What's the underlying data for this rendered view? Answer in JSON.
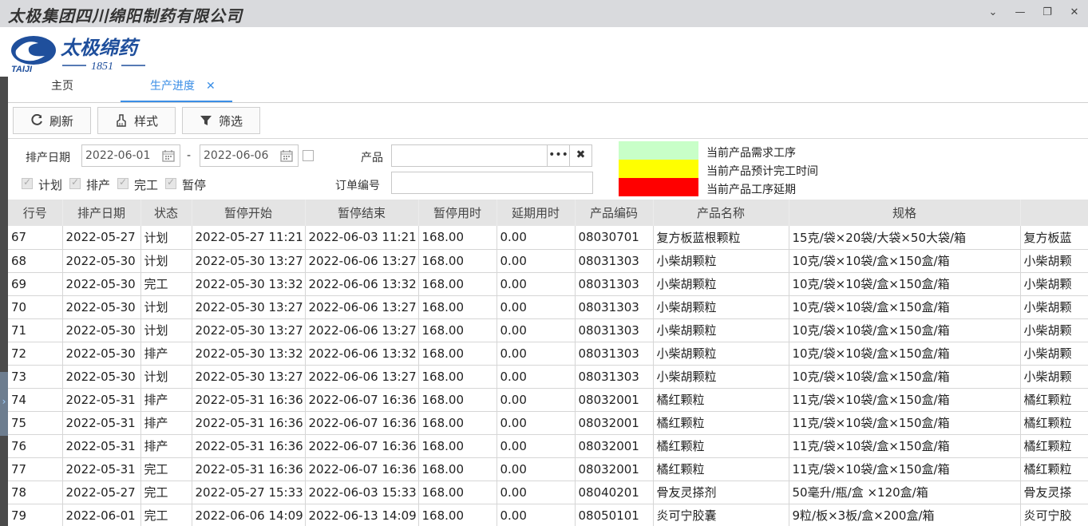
{
  "window": {
    "title": "太极集团四川绵阳制药有限公司"
  },
  "logo": {
    "brand": "太极绵药",
    "year": "1851",
    "sub": "TAIJI"
  },
  "tabs": [
    {
      "label": "主页"
    },
    {
      "label": "生产进度",
      "close": "✕"
    }
  ],
  "toolbar": {
    "refresh": "刷新",
    "style": "样式",
    "filter": "筛选"
  },
  "filters": {
    "date_label": "排产日期",
    "date_from": "2022-06-01",
    "date_sep": "-",
    "date_to": "2022-06-06",
    "product_label": "产品",
    "order_label": "订单编号",
    "ellipsis": "•••",
    "clear": "✖",
    "status_checks": [
      {
        "label": "计划",
        "checked": true
      },
      {
        "label": "排产",
        "checked": true
      },
      {
        "label": "完工",
        "checked": true
      },
      {
        "label": "暂停",
        "checked": true
      }
    ]
  },
  "legend": [
    {
      "color": "#c8ffc8",
      "label": "当前产品需求工序"
    },
    {
      "color": "#ffff00",
      "label": "当前产品预计完工时间"
    },
    {
      "color": "#ff0000",
      "label": "当前产品工序延期"
    }
  ],
  "table": {
    "columns": [
      "行号",
      "排产日期",
      "状态",
      "暂停开始",
      "暂停结束",
      "暂停用时",
      "延期用时",
      "产品编码",
      "产品名称",
      "规格",
      ""
    ],
    "rows": [
      [
        "67",
        "2022-05-27",
        "计划",
        "2022-05-27 11:21",
        "2022-06-03 11:21",
        "168.00",
        "0.00",
        "08030701",
        "复方板蓝根颗粒",
        "15克/袋×20袋/大袋×50大袋/箱",
        "复方板蓝"
      ],
      [
        "68",
        "2022-05-30",
        "计划",
        "2022-05-30 13:27",
        "2022-06-06 13:27",
        "168.00",
        "0.00",
        "08031303",
        "小柴胡颗粒",
        "10克/袋×10袋/盒×150盒/箱",
        "小柴胡颗"
      ],
      [
        "69",
        "2022-05-30",
        "完工",
        "2022-05-30 13:32",
        "2022-06-06 13:32",
        "168.00",
        "0.00",
        "08031303",
        "小柴胡颗粒",
        "10克/袋×10袋/盒×150盒/箱",
        "小柴胡颗"
      ],
      [
        "70",
        "2022-05-30",
        "计划",
        "2022-05-30 13:27",
        "2022-06-06 13:27",
        "168.00",
        "0.00",
        "08031303",
        "小柴胡颗粒",
        "10克/袋×10袋/盒×150盒/箱",
        "小柴胡颗"
      ],
      [
        "71",
        "2022-05-30",
        "计划",
        "2022-05-30 13:27",
        "2022-06-06 13:27",
        "168.00",
        "0.00",
        "08031303",
        "小柴胡颗粒",
        "10克/袋×10袋/盒×150盒/箱",
        "小柴胡颗"
      ],
      [
        "72",
        "2022-05-30",
        "排产",
        "2022-05-30 13:32",
        "2022-06-06 13:32",
        "168.00",
        "0.00",
        "08031303",
        "小柴胡颗粒",
        "10克/袋×10袋/盒×150盒/箱",
        "小柴胡颗"
      ],
      [
        "73",
        "2022-05-30",
        "计划",
        "2022-05-30 13:27",
        "2022-06-06 13:27",
        "168.00",
        "0.00",
        "08031303",
        "小柴胡颗粒",
        "10克/袋×10袋/盒×150盒/箱",
        "小柴胡颗"
      ],
      [
        "74",
        "2022-05-31",
        "排产",
        "2022-05-31 16:36",
        "2022-06-07 16:36",
        "168.00",
        "0.00",
        "08032001",
        "橘红颗粒",
        "11克/袋×10袋/盒×150盒/箱",
        "橘红颗粒"
      ],
      [
        "75",
        "2022-05-31",
        "排产",
        "2022-05-31 16:36",
        "2022-06-07 16:36",
        "168.00",
        "0.00",
        "08032001",
        "橘红颗粒",
        "11克/袋×10袋/盒×150盒/箱",
        "橘红颗粒"
      ],
      [
        "76",
        "2022-05-31",
        "排产",
        "2022-05-31 16:36",
        "2022-06-07 16:36",
        "168.00",
        "0.00",
        "08032001",
        "橘红颗粒",
        "11克/袋×10袋/盒×150盒/箱",
        "橘红颗粒"
      ],
      [
        "77",
        "2022-05-31",
        "完工",
        "2022-05-31 16:36",
        "2022-06-07 16:36",
        "168.00",
        "0.00",
        "08032001",
        "橘红颗粒",
        "11克/袋×10袋/盒×150盒/箱",
        "橘红颗粒"
      ],
      [
        "78",
        "2022-05-27",
        "完工",
        "2022-05-27 15:33",
        "2022-06-03 15:33",
        "168.00",
        "0.00",
        "08040201",
        "骨友灵搽剂",
        "50毫升/瓶/盒 ×120盒/箱",
        "骨友灵搽"
      ],
      [
        "79",
        "2022-06-01",
        "完工",
        "2022-06-06 14:09",
        "2022-06-13 14:09",
        "168.00",
        "0.00",
        "08050101",
        "炎可宁胶囊",
        "9粒/板×3板/盒×200盒/箱",
        "炎可宁胶"
      ]
    ]
  }
}
